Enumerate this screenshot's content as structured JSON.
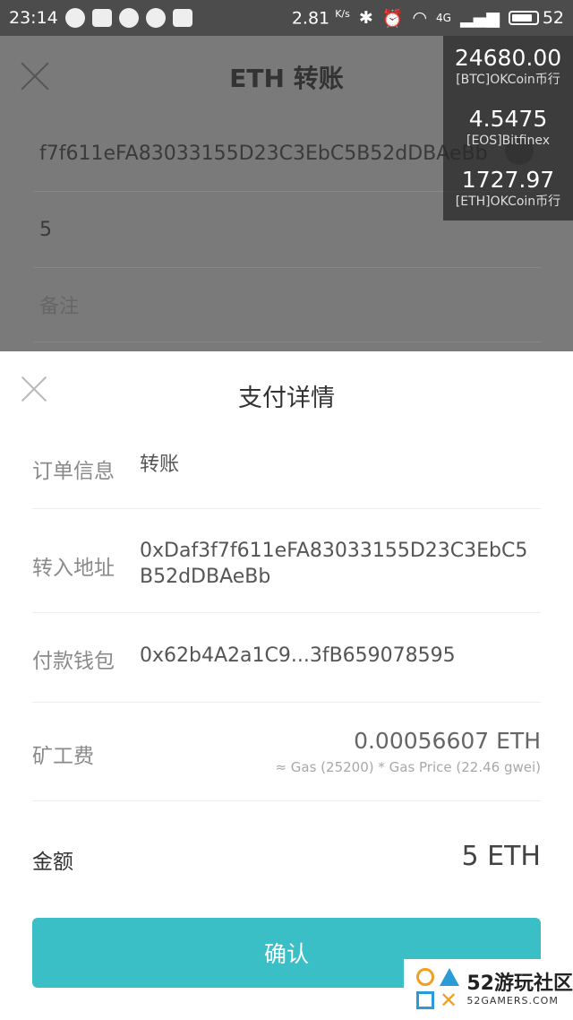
{
  "status_bar": {
    "time": "23:14",
    "speed": "2.81",
    "speed_unit": "K/s",
    "network": "4G",
    "battery": "52"
  },
  "background_screen": {
    "title": "ETH 转账",
    "address": "f7f611eFA83033155D23C3EbC5B52dDBAeBb",
    "amount": "5",
    "memo_placeholder": "备注"
  },
  "ticker": [
    {
      "price": "24680.00",
      "source": "[BTC]OKCoin币行"
    },
    {
      "price": "4.5475",
      "source": "[EOS]Bitfinex"
    },
    {
      "price": "1727.97",
      "source": "[ETH]OKCoin币行"
    }
  ],
  "sheet": {
    "title": "支付详情",
    "order_label": "订单信息",
    "order_value": "转账",
    "to_label": "转入地址",
    "to_value": "0xDaf3f7f611eFA83033155D23C3EbC5B52dDBAeBb",
    "wallet_label": "付款钱包",
    "wallet_value": "0x62b4A2a1C9...3fB659078595",
    "fee_label": "矿工费",
    "fee_value": "0.00056607 ETH",
    "fee_detail": "≈ Gas (25200) * Gas Price (22.46 gwei)",
    "amount_label": "金额",
    "amount_value": "5 ETH",
    "confirm_label": "确认"
  },
  "watermark": {
    "big": "52游玩社区",
    "small": "52GAMERS.COM"
  },
  "colors": {
    "accent": "#3bbfc6",
    "status_bar": "#4c4c4c",
    "overlay": "#7a7a7a"
  }
}
